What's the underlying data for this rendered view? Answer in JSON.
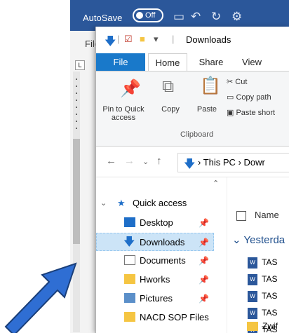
{
  "word": {
    "autosave_label": "AutoSave",
    "autosave_state": "Off",
    "file_tab": "File",
    "ruler_corner": "L"
  },
  "explorer": {
    "title": "Downloads",
    "tabs": {
      "file": "File",
      "home": "Home",
      "share": "Share",
      "view": "View"
    },
    "ribbon": {
      "pin": "Pin to Quick access",
      "copy": "Copy",
      "paste": "Paste",
      "cut": "Cut",
      "copy_path": "Copy path",
      "paste_shortcut": "Paste short",
      "group_label": "Clipboard"
    },
    "address": {
      "root": "This PC",
      "next": "Dowr"
    },
    "nav": {
      "quick_access": "Quick access",
      "items": [
        {
          "label": "Desktop",
          "icon": "desktop-icon",
          "pinned": true
        },
        {
          "label": "Downloads",
          "icon": "downloads-icon",
          "pinned": true,
          "selected": true
        },
        {
          "label": "Documents",
          "icon": "documents-icon",
          "pinned": true
        },
        {
          "label": "Hworks",
          "icon": "folder-icon",
          "pinned": true
        },
        {
          "label": "Pictures",
          "icon": "pictures-icon",
          "pinned": true
        },
        {
          "label": "NACD SOP Files",
          "icon": "folder-icon",
          "pinned": false
        }
      ]
    },
    "files": {
      "name_header": "Name",
      "group": "Yesterda",
      "items": [
        "TAS",
        "TAS",
        "TAS",
        "TAS",
        "TAS",
        "Zwif"
      ]
    }
  },
  "colors": {
    "word_blue": "#2b579a",
    "file_tab_blue": "#1979ca",
    "selection": "#cce4f7",
    "arrow": "#2f6ed3"
  }
}
